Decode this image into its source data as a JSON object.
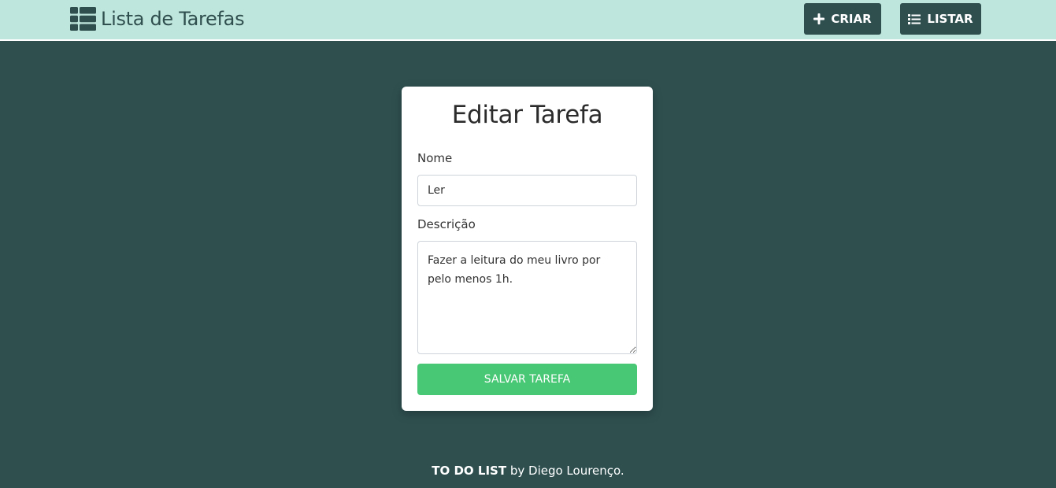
{
  "navbar": {
    "brand_icon": "table-list-icon",
    "brand_title": "Lista de Tarefas",
    "create_button": {
      "icon": "plus-icon",
      "label": "CRIAR"
    },
    "list_button": {
      "icon": "list-icon",
      "label": "LISTAR"
    }
  },
  "form": {
    "title": "Editar Tarefa",
    "name_label": "Nome",
    "name_value": "Ler",
    "description_label": "Descrição",
    "description_value": "Fazer a leitura do meu livro por pelo menos 1h.",
    "submit_label": "SALVAR TAREFA"
  },
  "footer": {
    "app_name": "TO DO LIST",
    "credit": " by Diego Lourenço."
  },
  "colors": {
    "background": "#2f4f4f",
    "navbar": "#bfe6dc",
    "accent": "#48c774"
  }
}
